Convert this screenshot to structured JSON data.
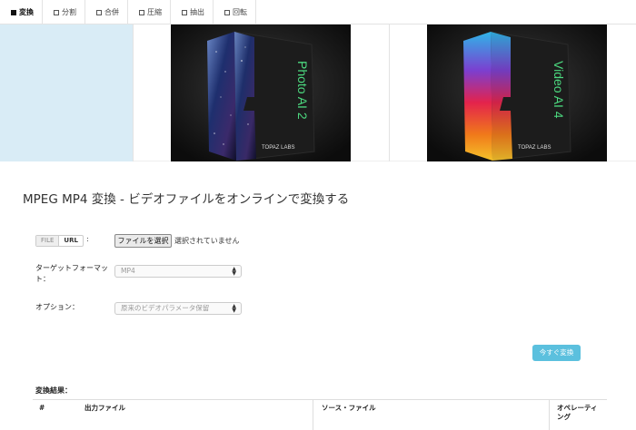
{
  "tabs": [
    {
      "label": "変換",
      "active": true
    },
    {
      "label": "分割",
      "active": false
    },
    {
      "label": "合併",
      "active": false
    },
    {
      "label": "圧縮",
      "active": false
    },
    {
      "label": "抽出",
      "active": false
    },
    {
      "label": "回転",
      "active": false
    }
  ],
  "ads": {
    "photo": {
      "title": "Photo AI 2",
      "brand": "TOPAZ LABS"
    },
    "video": {
      "title": "Video AI 4",
      "brand": "TOPAZ LABS"
    }
  },
  "page_title": "MPEG MP4 変換 - ビデオファイルをオンラインで変換する",
  "source": {
    "file_label": "FILE",
    "url_label": "URL",
    "colon": ":"
  },
  "file_input": {
    "button": "ファイルを選択",
    "status": "選択されていません"
  },
  "target_format": {
    "label": "ターゲットフォーマット：",
    "value": "MP4"
  },
  "options": {
    "label": "オプション：",
    "value": "原来のビデオパラメータ保留"
  },
  "convert_button": "今すぐ変換",
  "results": {
    "title": "変換結果：",
    "columns": [
      "#",
      "出力ファイル",
      "ソース・ファイル",
      "オペレーティング"
    ]
  },
  "colors": {
    "accent": "#5bc0de",
    "banner_blue": "#d9ecf6",
    "photo_title": "#4cd97f",
    "video_title": "#4cd97f"
  }
}
